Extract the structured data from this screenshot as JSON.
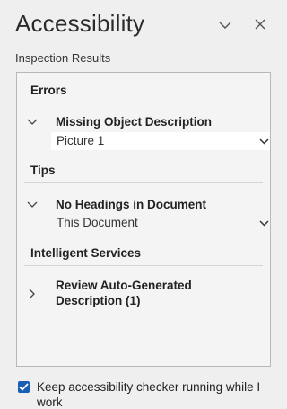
{
  "pane": {
    "title": "Accessibility",
    "collapse_icon": "chevron-down-icon",
    "close_icon": "close-icon"
  },
  "results": {
    "caption": "Inspection Results",
    "errors": {
      "header": "Errors",
      "items": [
        {
          "name": "Missing Object Description",
          "target": "Picture 1",
          "expanded": true
        }
      ]
    },
    "tips": {
      "header": "Tips",
      "items": [
        {
          "name": "No Headings in Document",
          "target": "This Document",
          "expanded": true
        }
      ]
    },
    "intelligent_services": {
      "header": "Intelligent Services",
      "items": [
        {
          "name": "Review Auto-Generated Description (1)",
          "expanded": false
        }
      ]
    }
  },
  "footer": {
    "keep_running_label": "Keep accessibility checker running while I work",
    "keep_running_checked": true
  },
  "colors": {
    "pane_background": "#efefef",
    "checkbox_accent": "#1a5fb4",
    "target_field_background": "#ffffff"
  }
}
